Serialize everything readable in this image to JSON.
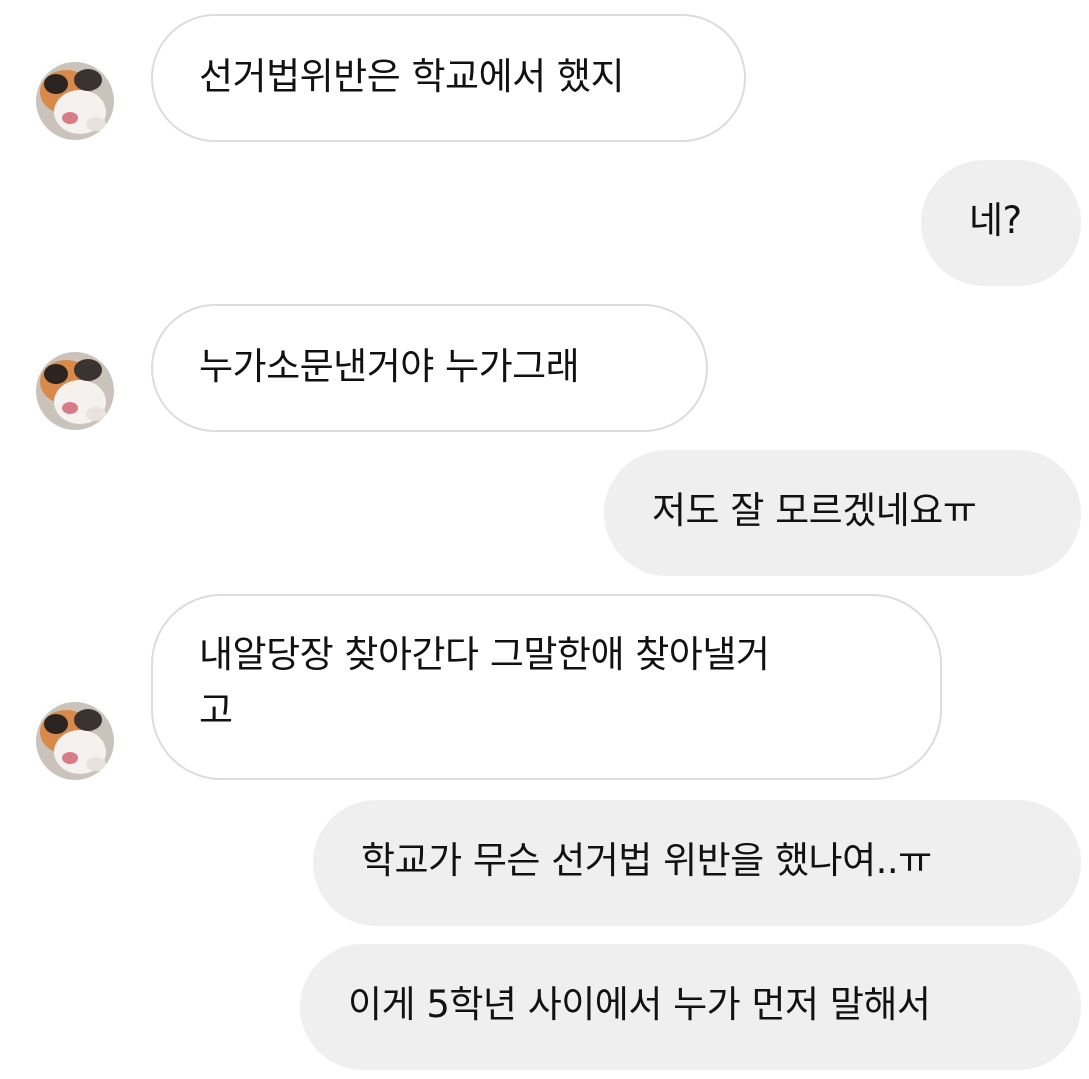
{
  "colors": {
    "incoming_bg": "#ffffff",
    "incoming_border": "#dcdcdc",
    "outgoing_bg": "#efefef",
    "text": "#111111"
  },
  "messages": [
    {
      "sender": "other",
      "text": "선거법위반은 학교에서 했지"
    },
    {
      "sender": "me",
      "text": "네?"
    },
    {
      "sender": "other",
      "text": "누가소문낸거야  누가그래"
    },
    {
      "sender": "me",
      "text": "저도 잘 모르겠네요ㅠ"
    },
    {
      "sender": "other",
      "line1": "내알당장 찾아간다  그말한애  찾아낼거",
      "line2": "고"
    },
    {
      "sender": "me",
      "text": "학교가 무슨 선거법 위반을 했나여..ㅠ"
    },
    {
      "sender": "me",
      "text": "이게 5학년 사이에서 누가 먼저 말해서"
    }
  ],
  "avatar_icon": "cat-profile-avatar-icon"
}
